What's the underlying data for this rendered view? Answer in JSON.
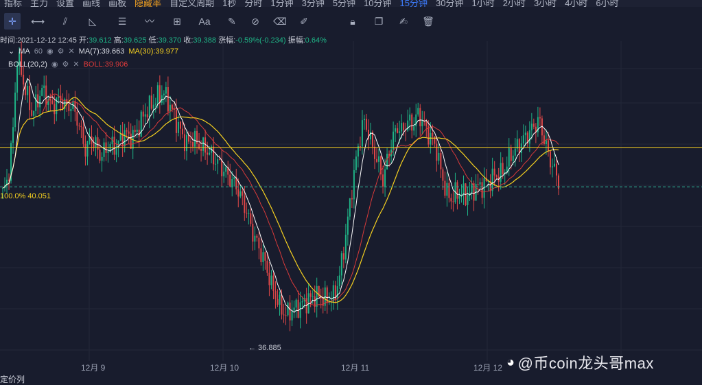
{
  "topbar": {
    "items": [
      "指标",
      "主力",
      "设置",
      "画线",
      "画板",
      "隐藏率",
      "自定义周期",
      "1秒",
      "分时",
      "1分钟",
      "3分钟",
      "5分钟",
      "10分钟",
      "15分钟",
      "30分钟",
      "1小时",
      "2小时",
      "3小时",
      "4小时",
      "6小时"
    ],
    "active_index": 13
  },
  "toolbar": {
    "icons": [
      "crosshair-icon",
      "horizontal-line-icon",
      "parallel-channel-icon",
      "triangle-ruler-icon",
      "fib-lines-icon",
      "wave-icon",
      "add-box-icon",
      "text-aa-icon",
      "pencil-grid-icon",
      "pencil-off-icon",
      "eraser-icon",
      "brush-icon",
      "lock-icon",
      "duplicate-icon",
      "edit-doc-icon",
      "trash-icon"
    ],
    "text_tool_label": "Aa",
    "selected_index": 0
  },
  "ohlc": {
    "time_label": "时间:",
    "time": "2021-12-12 12:45",
    "open_label": "开:",
    "open": "39.612",
    "high_label": "高:",
    "high": "39.625",
    "low_label": "低:",
    "low": "39.370",
    "close_label": "收:",
    "close": "39.388",
    "change_label": "涨幅:",
    "change": "-0.59%(-0.234)",
    "amp_label": "振幅:",
    "amp": "0.64%"
  },
  "indicators": {
    "ma_name": "MA",
    "ma_hidden": "60",
    "ma7": "MA(7):39.663",
    "ma30": "MA(30):39.977",
    "boll_name": "BOLL(20,2)",
    "boll": "BOLL:39.906"
  },
  "price_line": {
    "label": "100.0% 40.051"
  },
  "low_marker": {
    "label": "← 36.885"
  },
  "x_axis": {
    "labels": [
      "12月 9",
      "12月 10",
      "12月 11",
      "12月 12"
    ]
  },
  "watermark": {
    "text": "@币coin龙头哥max"
  },
  "bottom": {
    "label": "定价列"
  },
  "colors": {
    "bg": "#181c2d",
    "up": "#1fb386",
    "down": "#e04848",
    "ma7": "#ffffff",
    "ma30": "#f5d020",
    "boll": "#d93a3a"
  },
  "chart_data": {
    "type": "candlestick",
    "ylim": [
      36.6,
      41.8
    ],
    "price_line": 40.051,
    "low": 36.885,
    "closes": [
      39.3,
      39.5,
      40.2,
      41.6,
      41.2,
      40.9,
      40.6,
      40.8,
      41.0,
      40.9,
      40.7,
      40.8,
      40.85,
      40.7,
      40.75,
      40.6,
      40.3,
      40.0,
      40.2,
      40.1,
      39.9,
      40.0,
      40.1,
      40.05,
      40.15,
      40.3,
      40.2,
      40.25,
      40.4,
      40.6,
      40.7,
      40.8,
      40.9,
      40.95,
      40.8,
      40.6,
      40.4,
      40.2,
      40.1,
      40.2,
      40.1,
      40.05,
      40.0,
      39.9,
      39.8,
      39.7,
      39.6,
      39.5,
      39.4,
      39.2,
      39.0,
      38.7,
      38.5,
      38.3,
      38.1,
      37.8,
      37.6,
      37.4,
      37.3,
      37.35,
      37.4,
      37.45,
      37.5,
      37.55,
      37.6,
      37.6,
      37.55,
      37.55,
      37.6,
      37.9,
      38.4,
      39.0,
      39.6,
      40.1,
      40.5,
      40.3,
      40.0,
      39.8,
      39.5,
      39.9,
      40.2,
      40.4,
      40.3,
      40.5,
      40.4,
      40.6,
      40.5,
      40.3,
      40.2,
      40.0,
      39.6,
      39.3,
      39.2,
      39.3,
      39.3,
      39.25,
      39.3,
      39.4,
      39.4,
      39.45,
      39.5,
      39.6,
      39.6,
      39.7,
      39.9,
      40.0,
      40.1,
      40.2,
      40.3,
      40.4,
      40.5,
      40.2,
      39.9,
      39.7,
      39.5
    ]
  }
}
